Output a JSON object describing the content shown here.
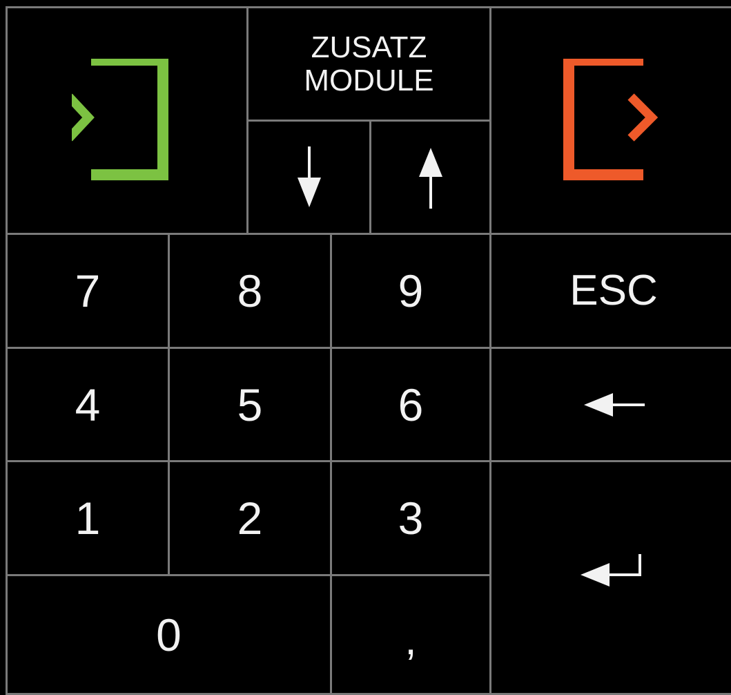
{
  "keypad": {
    "top": {
      "login_icon": "login-arrow-bracket-icon",
      "logout_icon": "logout-arrow-bracket-icon",
      "zusatz_line1": "ZUSATZ",
      "zusatz_line2": "MODULE",
      "down_icon": "arrow-down-icon",
      "up_icon": "arrow-up-icon"
    },
    "digits": {
      "seven": "7",
      "eight": "8",
      "nine": "9",
      "four": "4",
      "five": "5",
      "six": "6",
      "one": "1",
      "two": "2",
      "three": "3",
      "zero": "0",
      "comma": ","
    },
    "esc": "ESC",
    "backspace_icon": "arrow-left-icon",
    "enter_icon": "enter-return-icon"
  },
  "colors": {
    "background": "#000000",
    "border": "#7a7a7a",
    "text": "#f2f2f2",
    "login_green": "#7cc242",
    "logout_orange": "#ee5a2a"
  }
}
